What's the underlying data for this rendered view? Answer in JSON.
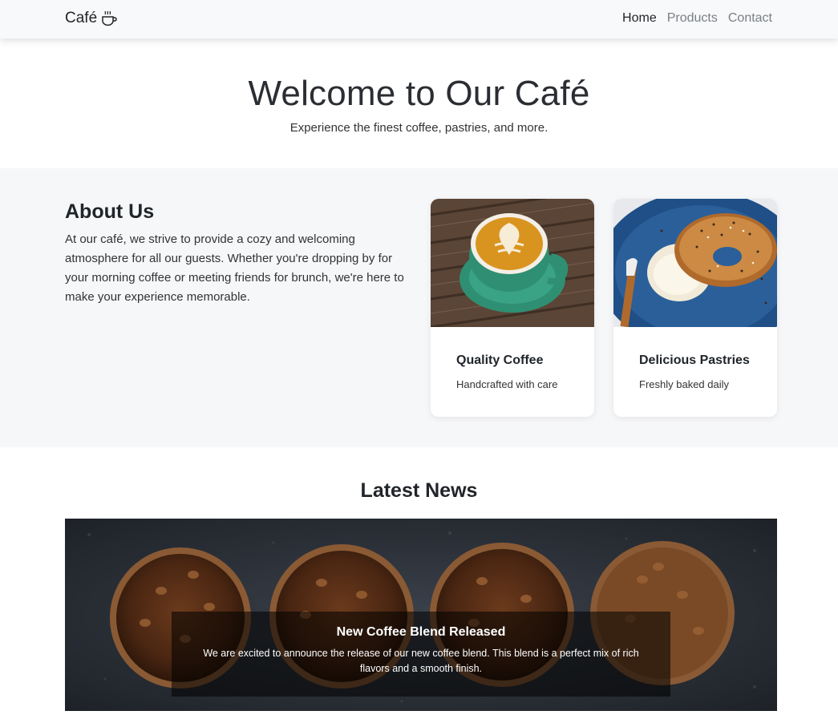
{
  "navbar": {
    "brand": "Café",
    "brand_icon": "coffee-cup-icon",
    "items": [
      {
        "label": "Home",
        "active": true
      },
      {
        "label": "Products",
        "active": false
      },
      {
        "label": "Contact",
        "active": false
      }
    ]
  },
  "hero": {
    "title": "Welcome to Our Café",
    "subtitle": "Experience the finest coffee, pastries, and more."
  },
  "about": {
    "heading": "About Us",
    "text": "At our café, we strive to provide a cozy and welcoming atmosphere for all our guests. Whether you're dropping by for your morning coffee or meeting friends for brunch, we're here to make your experience memorable.",
    "cards": [
      {
        "title": "Quality Coffee",
        "subtitle": "Handcrafted with care",
        "image": "latte-art-cup-photo"
      },
      {
        "title": "Delicious Pastries",
        "subtitle": "Freshly baked daily",
        "image": "bagel-cream-cheese-photo"
      }
    ]
  },
  "news": {
    "heading": "Latest News",
    "slide": {
      "title": "New Coffee Blend Released",
      "text": "We are excited to announce the release of our new coffee blend. This blend is a perfect mix of rich flavors and a smooth finish.",
      "image": "coffee-beans-bowls-photo"
    }
  },
  "colors": {
    "navbar_bg": "#f8f9fa",
    "section_bg": "#f6f7f9",
    "text": "#212529",
    "muted_nav": "#7a7f85"
  }
}
